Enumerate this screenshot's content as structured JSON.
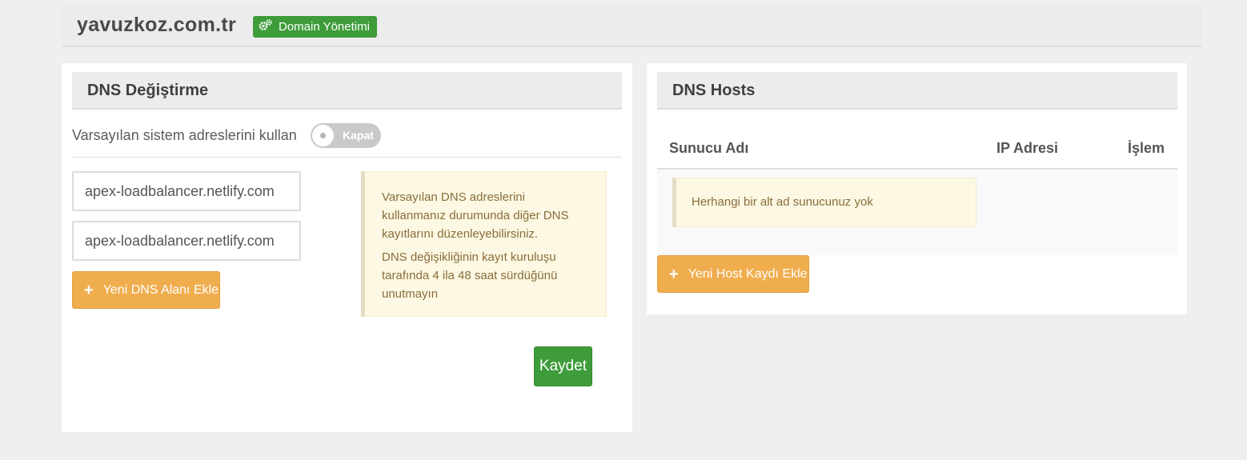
{
  "header": {
    "domain": "yavuzkoz.com.tr",
    "badge_label": "Domain Yönetimi",
    "badge_icon": "gears-icon"
  },
  "dns_panel": {
    "title": "DNS Değiştirme",
    "toggle_label": "Varsayılan sistem adreslerini kullan",
    "toggle_state": "Kapat",
    "nameservers": [
      "apex-loadbalancer.netlify.com",
      "apex-loadbalancer.netlify.com"
    ],
    "add_button": "Yeni DNS Alanı Ekle",
    "info_lines": [
      "Varsayılan DNS adreslerini kullanmanız durumunda diğer DNS kayıtlarını düzenleyebilirsiniz.",
      "DNS değişikliğinin kayıt kuruluşu tarafında 4 ila 48 saat sürdüğünü unutmayın"
    ],
    "save_button": "Kaydet"
  },
  "hosts_panel": {
    "title": "DNS Hosts",
    "columns": [
      "Sunucu Adı",
      "IP Adresi",
      "İşlem"
    ],
    "empty_message": "Herhangi bir alt ad sunucunuz yok",
    "add_button": "Yeni Host Kaydı Ekle"
  },
  "colors": {
    "accent_green": "#3e9c3a",
    "accent_orange": "#f0ad4e",
    "warning_bg": "#fcf8e3",
    "warning_text": "#8a6d3b"
  }
}
